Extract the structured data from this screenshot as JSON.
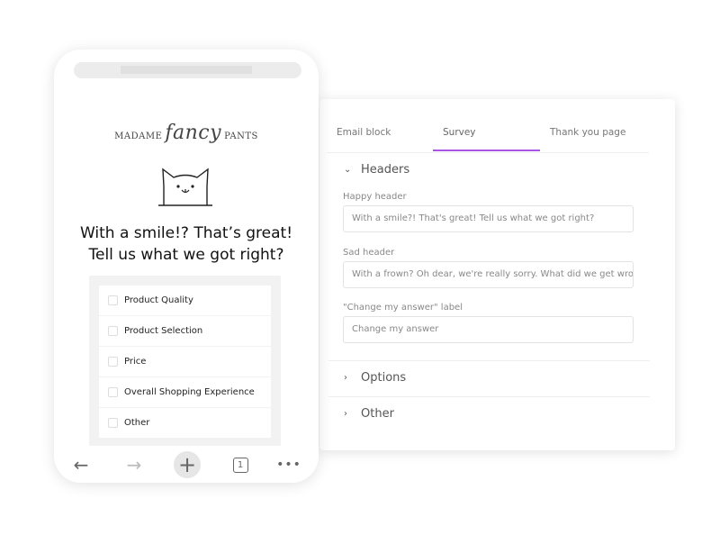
{
  "editor": {
    "tabs": [
      {
        "label": "Email block"
      },
      {
        "label": "Survey",
        "active": true
      },
      {
        "label": "Thank you page"
      }
    ],
    "accent": "#a855e6",
    "headers_section": "Headers",
    "fields": [
      {
        "label": "Happy header",
        "value": "With a smile?! That's great! Tell us what we got right?"
      },
      {
        "label": "Sad header",
        "value": "With a frown? Oh dear, we're really sorry. What did we get wrong?"
      },
      {
        "label": "\"Change my answer\" label",
        "value": "Change my answer"
      }
    ],
    "options_section": "Options",
    "other_section": "Other"
  },
  "phone": {
    "logo": {
      "left": "MADAME",
      "mid": "fancy",
      "right": "PANTS"
    },
    "headline_1": "With a smile!? That’s great!",
    "headline_2": "Tell us what we got right?",
    "options": [
      "Product Quality",
      "Product Selection",
      "Price",
      "Overall Shopping Experience",
      "Other"
    ],
    "tab_count": "1"
  }
}
